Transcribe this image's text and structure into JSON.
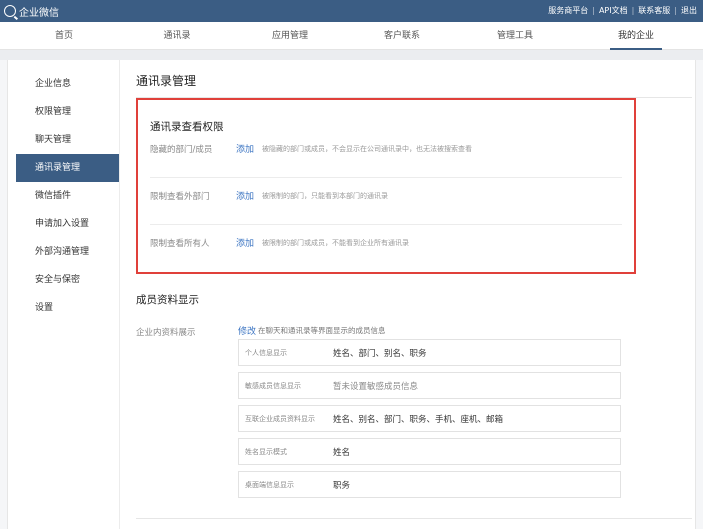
{
  "topbar": {
    "app_title": "企业微信",
    "links": [
      "服务商平台",
      "API文档",
      "联系客服",
      "退出"
    ]
  },
  "nav": {
    "tabs": [
      "首页",
      "通讯录",
      "应用管理",
      "客户联系",
      "管理工具",
      "我的企业"
    ],
    "active": "我的企业"
  },
  "sidebar": {
    "items": [
      "企业信息",
      "权限管理",
      "聊天管理",
      "通讯录管理",
      "微信插件",
      "申请加入设置",
      "外部沟通管理",
      "安全与保密",
      "设置"
    ],
    "active": "通讯录管理"
  },
  "main": {
    "page_title": "通讯录管理",
    "view_permission": {
      "title": "通讯录查看权限",
      "rows": [
        {
          "label": "隐藏的部门/成员",
          "action": "添加",
          "desc": "被隐藏的部门或成员，不会显示在公司通讯录中，也无法被搜索查看"
        },
        {
          "label": "限制查看外部门",
          "action": "添加",
          "desc": "被限制的部门，只能看到本部门的通讯录"
        },
        {
          "label": "限制查看所有人",
          "action": "添加",
          "desc": "被限制的部门或成员，不能看到企业所有通讯录"
        }
      ]
    },
    "member_display": {
      "title": "成员资料显示",
      "label": "企业内资料展示",
      "action": "修改",
      "desc": "在聊天和通讯录等界面显示的成员信息",
      "items": [
        {
          "key": "个人信息显示",
          "value": "姓名、部门、别名、职务"
        },
        {
          "key": "敏感成员信息显示",
          "value": "暂未设置敏感成员信息"
        },
        {
          "key": "互联企业成员资料显示",
          "value": "姓名、别名、部门、职务、手机、座机、邮箱"
        },
        {
          "key": "姓名显示模式",
          "value": "姓名"
        },
        {
          "key": "桌面端信息显示",
          "value": "职务"
        }
      ]
    }
  },
  "colors": {
    "topbar": "#3b5d84",
    "active_nav": "#3b5d84",
    "highlight_border": "#e0403a",
    "link": "#3b74c2"
  }
}
